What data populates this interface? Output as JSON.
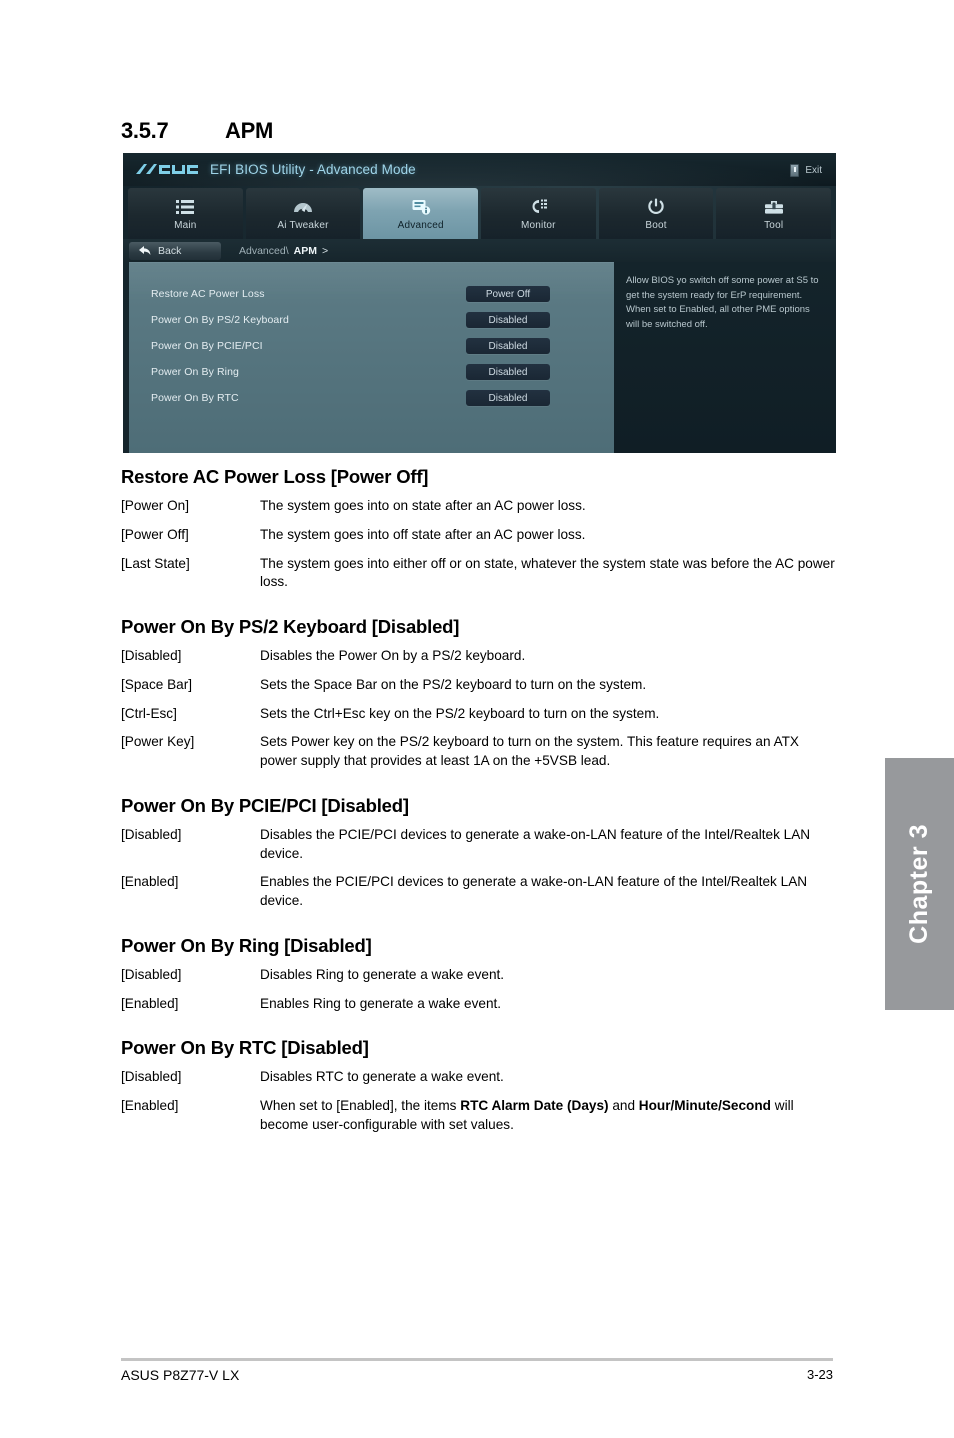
{
  "section": {
    "number": "3.5.7",
    "title": "APM"
  },
  "bios": {
    "brand": "ASUS",
    "title": "EFI BIOS Utility - Advanced Mode",
    "exit_label": "Exit",
    "tabs": [
      {
        "label": "Main",
        "icon": "list-icon",
        "active": false
      },
      {
        "label": "Ai  Tweaker",
        "icon": "speedometer-icon",
        "active": false
      },
      {
        "label": "Advanced",
        "icon": "chip-icon",
        "active": true
      },
      {
        "label": "Monitor",
        "icon": "gauge-icon",
        "active": false
      },
      {
        "label": "Boot",
        "icon": "power-icon",
        "active": false
      },
      {
        "label": "Tool",
        "icon": "toolbox-icon",
        "active": false
      }
    ],
    "back_label": "Back",
    "breadcrumb_parent": "Advanced\\",
    "breadcrumb_current": "APM",
    "breadcrumb_arrow": ">",
    "options": [
      {
        "label": "Restore AC Power Loss",
        "value": "Power Off"
      },
      {
        "label": "Power On By PS/2 Keyboard",
        "value": "Disabled"
      },
      {
        "label": "Power On By PCIE/PCI",
        "value": "Disabled"
      },
      {
        "label": "Power On By Ring",
        "value": "Disabled"
      },
      {
        "label": "Power On By RTC",
        "value": "Disabled"
      }
    ],
    "help_text": "Allow BIOS yo switch off some power at S5 to get the system ready for ErP requirement. When set to Enabled, all other PME options will be switched off."
  },
  "items": [
    {
      "heading": "Restore AC Power Loss [Power Off]",
      "defs": [
        {
          "key": "[Power On]",
          "value": "The system goes into on state after an AC power loss."
        },
        {
          "key": "[Power Off]",
          "value": "The system goes into off state after an AC power loss."
        },
        {
          "key": "[Last State]",
          "value": "The system goes into either off or on state, whatever the system state was before the AC power loss."
        }
      ]
    },
    {
      "heading": "Power On By PS/2 Keyboard [Disabled]",
      "defs": [
        {
          "key": "[Disabled]",
          "value": "Disables the Power On by a PS/2 keyboard."
        },
        {
          "key": "[Space Bar]",
          "value": "Sets the Space Bar on the PS/2 keyboard to turn on the system."
        },
        {
          "key": "[Ctrl-Esc]",
          "value": "Sets the Ctrl+Esc key on the PS/2 keyboard to turn on the system."
        },
        {
          "key": "[Power Key]",
          "value": "Sets Power key on the PS/2 keyboard to turn on the system. This feature requires an ATX power supply that provides at least 1A on the +5VSB lead."
        }
      ]
    },
    {
      "heading": "Power On By PCIE/PCI [Disabled]",
      "defs": [
        {
          "key": "[Disabled]",
          "value": "Disables the PCIE/PCI devices to generate a wake-on-LAN feature of the Intel/Realtek LAN device."
        },
        {
          "key": "[Enabled]",
          "value": "Enables the PCIE/PCI devices to generate a wake-on-LAN feature of the Intel/Realtek LAN device."
        }
      ]
    },
    {
      "heading": "Power On By Ring [Disabled]",
      "defs": [
        {
          "key": "[Disabled]",
          "value": "Disables Ring to generate a wake event."
        },
        {
          "key": "[Enabled]",
          "value": "Enables Ring to generate a wake event."
        }
      ]
    },
    {
      "heading": "Power On By RTC [Disabled]",
      "defs": [
        {
          "key": "[Disabled]",
          "value": "Disables RTC to generate a wake event."
        },
        {
          "key": "[Enabled]",
          "value": "",
          "rich": [
            {
              "t": "When set to [Enabled], the items ",
              "b": false
            },
            {
              "t": "RTC Alarm Date (Days)",
              "b": true
            },
            {
              "t": " and ",
              "b": false
            },
            {
              "t": "Hour/Minute/Second",
              "b": true
            },
            {
              "t": " will become user-configurable with set values.",
              "b": false
            }
          ]
        }
      ]
    }
  ],
  "chapter_tab": "Chapter 3",
  "footer": {
    "left": "ASUS P8Z77-V LX",
    "right": "3-23"
  }
}
